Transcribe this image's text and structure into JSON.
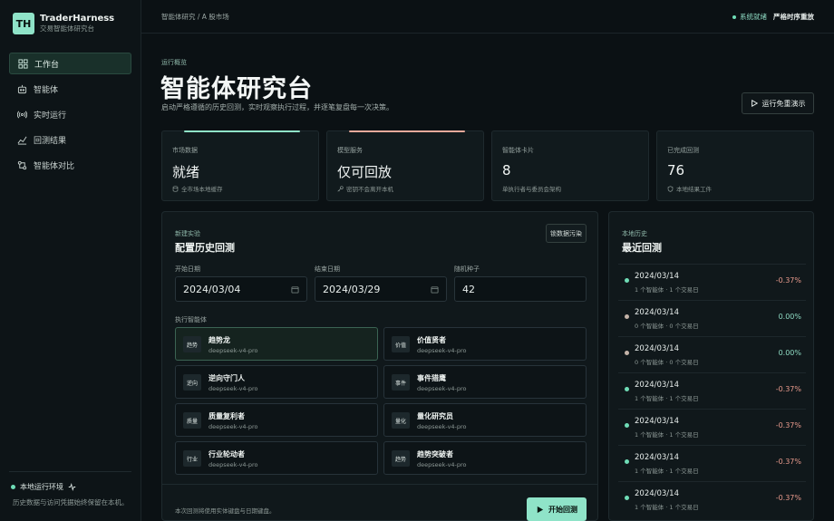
{
  "brand": {
    "logo": "TH",
    "name": "TraderHarness",
    "subtitle": "交易智能体研究台"
  },
  "nav": {
    "items": [
      {
        "label": "工作台",
        "icon": "grid-icon",
        "active": true
      },
      {
        "label": "智能体",
        "icon": "robot-icon",
        "active": false
      },
      {
        "label": "实时运行",
        "icon": "radio-icon",
        "active": false
      },
      {
        "label": "回测结果",
        "icon": "chart-icon",
        "active": false
      },
      {
        "label": "智能体对比",
        "icon": "compare-icon",
        "active": false
      }
    ]
  },
  "sidebar_footer": {
    "env_label": "本地运行环境",
    "note": "历史数据与访问凭据始终保留在本机。"
  },
  "topbar": {
    "breadcrumb": "智能体研究 / A 股市场",
    "status": "系统就绪",
    "mode": "严格时序重放"
  },
  "hero": {
    "eyebrow": "运行概览",
    "title": "智能体研究台",
    "description": "启动严格遵循的历史回测，实时观察执行过程，并逐笔复盘每一次决策。",
    "demo_button": "运行免重演示"
  },
  "stats": [
    {
      "label": "市场数据",
      "value": "就绪",
      "note": "全市场本地缓存",
      "icon": "database-icon",
      "accent": "#8fe3c8"
    },
    {
      "label": "模型服务",
      "value": "仅可回放",
      "note": "密钥不会离开本机",
      "icon": "key-icon",
      "accent": "#e8a99a"
    },
    {
      "label": "智能体卡片",
      "value": "8",
      "note": "单执行者与委员会架构",
      "icon": "",
      "accent": ""
    },
    {
      "label": "已完成回测",
      "value": "76",
      "note": "本地结果工件",
      "icon": "shield-icon",
      "accent": ""
    }
  ],
  "config": {
    "eyebrow": "新建实验",
    "title": "配置历史回测",
    "lock_button": "锁数据污染",
    "start_label": "开始日期",
    "start_value": "2024/03/04",
    "end_label": "结束日期",
    "end_value": "2024/03/29",
    "seed_label": "随机种子",
    "seed_value": "42",
    "agents_label": "执行智能体",
    "agents": [
      {
        "badge": "趋势",
        "name": "趋势龙",
        "model": "deepseek-v4-pro",
        "selected": true
      },
      {
        "badge": "价值",
        "name": "价值贤者",
        "model": "deepseek-v4-pro",
        "selected": false
      },
      {
        "badge": "逆向",
        "name": "逆向守门人",
        "model": "deepseek-v4-pro",
        "selected": false
      },
      {
        "badge": "事件",
        "name": "事件猎鹰",
        "model": "deepseek-v4-pro",
        "selected": false
      },
      {
        "badge": "质量",
        "name": "质量复利者",
        "model": "deepseek-v4-pro",
        "selected": false
      },
      {
        "badge": "量化",
        "name": "量化研究员",
        "model": "deepseek-v4-pro",
        "selected": false
      },
      {
        "badge": "行业",
        "name": "行业轮动者",
        "model": "deepseek-v4-pro",
        "selected": false
      },
      {
        "badge": "趋势",
        "name": "趋势突破者",
        "model": "deepseek-v4-pro",
        "selected": false
      }
    ],
    "footer_note": "本次回测将使用实体键盘与日期键盘。",
    "start_button": "开始回测"
  },
  "history": {
    "eyebrow": "本地历史",
    "title": "最近回测",
    "rows": [
      {
        "date": "2024/03/14",
        "meta": "1 个智能体 · 1 个交易日",
        "ret": "-0.37%",
        "dot": "#6fdcb6",
        "ret_color": "#e89a8c"
      },
      {
        "date": "2024/03/14",
        "meta": "0 个智能体 · 0 个交易日",
        "ret": "0.00%",
        "dot": "#c4b3a8",
        "ret_color": "#8fdcc4"
      },
      {
        "date": "2024/03/14",
        "meta": "0 个智能体 · 0 个交易日",
        "ret": "0.00%",
        "dot": "#c4b3a8",
        "ret_color": "#8fdcc4"
      },
      {
        "date": "2024/03/14",
        "meta": "1 个智能体 · 1 个交易日",
        "ret": "-0.37%",
        "dot": "#6fdcb6",
        "ret_color": "#e89a8c"
      },
      {
        "date": "2024/03/14",
        "meta": "1 个智能体 · 1 个交易日",
        "ret": "-0.37%",
        "dot": "#6fdcb6",
        "ret_color": "#e89a8c"
      },
      {
        "date": "2024/03/14",
        "meta": "1 个智能体 · 1 个交易日",
        "ret": "-0.37%",
        "dot": "#6fdcb6",
        "ret_color": "#e89a8c"
      },
      {
        "date": "2024/03/14",
        "meta": "1 个智能体 · 1 个交易日",
        "ret": "-0.37%",
        "dot": "#6fdcb6",
        "ret_color": "#e89a8c"
      }
    ]
  }
}
